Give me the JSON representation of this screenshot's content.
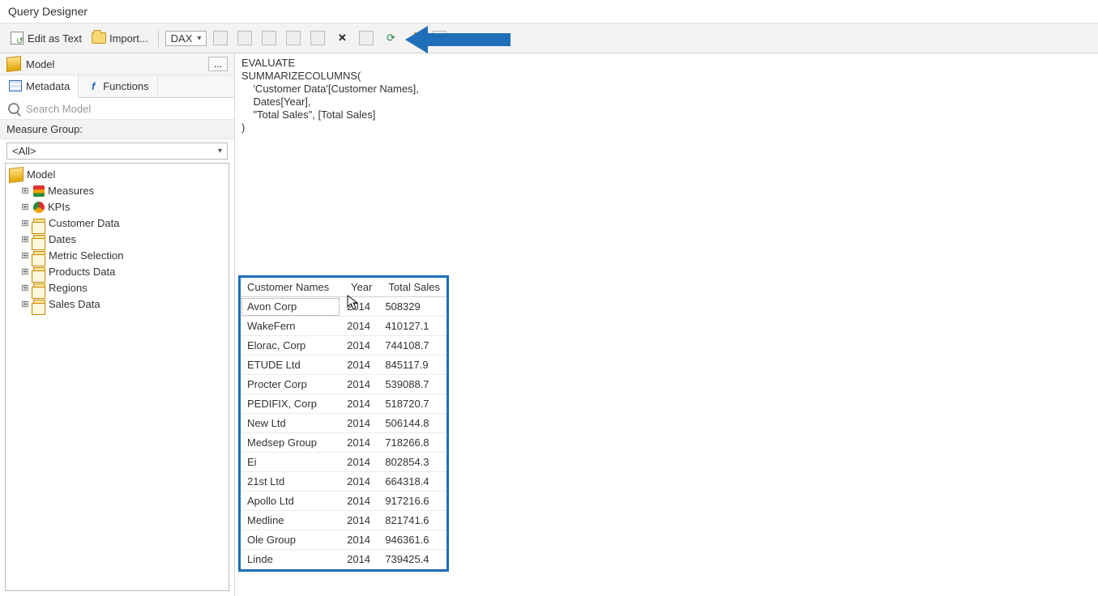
{
  "window": {
    "title": "Query Designer"
  },
  "toolbar": {
    "edit_as_text": "Edit as Text",
    "import": "Import...",
    "language_combo": "DAX"
  },
  "sidebar": {
    "model_label": "Model",
    "tabs": {
      "metadata": "Metadata",
      "functions": "Functions"
    },
    "search_placeholder": "Search Model",
    "measure_group_label": "Measure Group:",
    "measure_group_value": "<All>",
    "tree": {
      "root": "Model",
      "children": [
        "Measures",
        "KPIs",
        "Customer Data",
        "Dates",
        "Metric Selection",
        "Products Data",
        "Regions",
        "Sales Data"
      ]
    }
  },
  "editor": {
    "lines": [
      "EVALUATE",
      "SUMMARIZECOLUMNS(",
      "    'Customer Data'[Customer Names],",
      "    Dates[Year],",
      "    \"Total Sales\", [Total Sales]",
      ")"
    ]
  },
  "results": {
    "columns": [
      "Customer Names",
      "Year",
      "Total Sales"
    ],
    "rows": [
      {
        "c": "Avon Corp",
        "y": "2014",
        "t": "508329"
      },
      {
        "c": "WakeFern",
        "y": "2014",
        "t": "410127.1"
      },
      {
        "c": "Elorac, Corp",
        "y": "2014",
        "t": "744108.7"
      },
      {
        "c": "ETUDE Ltd",
        "y": "2014",
        "t": "845117.9"
      },
      {
        "c": "Procter Corp",
        "y": "2014",
        "t": "539088.7"
      },
      {
        "c": "PEDIFIX, Corp",
        "y": "2014",
        "t": "518720.7"
      },
      {
        "c": "New Ltd",
        "y": "2014",
        "t": "506144.8"
      },
      {
        "c": "Medsep Group",
        "y": "2014",
        "t": "718266.8"
      },
      {
        "c": "Ei",
        "y": "2014",
        "t": "802854.3"
      },
      {
        "c": "21st Ltd",
        "y": "2014",
        "t": "664318.4"
      },
      {
        "c": "Apollo Ltd",
        "y": "2014",
        "t": "917216.6"
      },
      {
        "c": "Medline",
        "y": "2014",
        "t": "821741.6"
      },
      {
        "c": "Ole Group",
        "y": "2014",
        "t": "946361.6"
      },
      {
        "c": "Linde",
        "y": "2014",
        "t": "739425.4"
      }
    ]
  }
}
